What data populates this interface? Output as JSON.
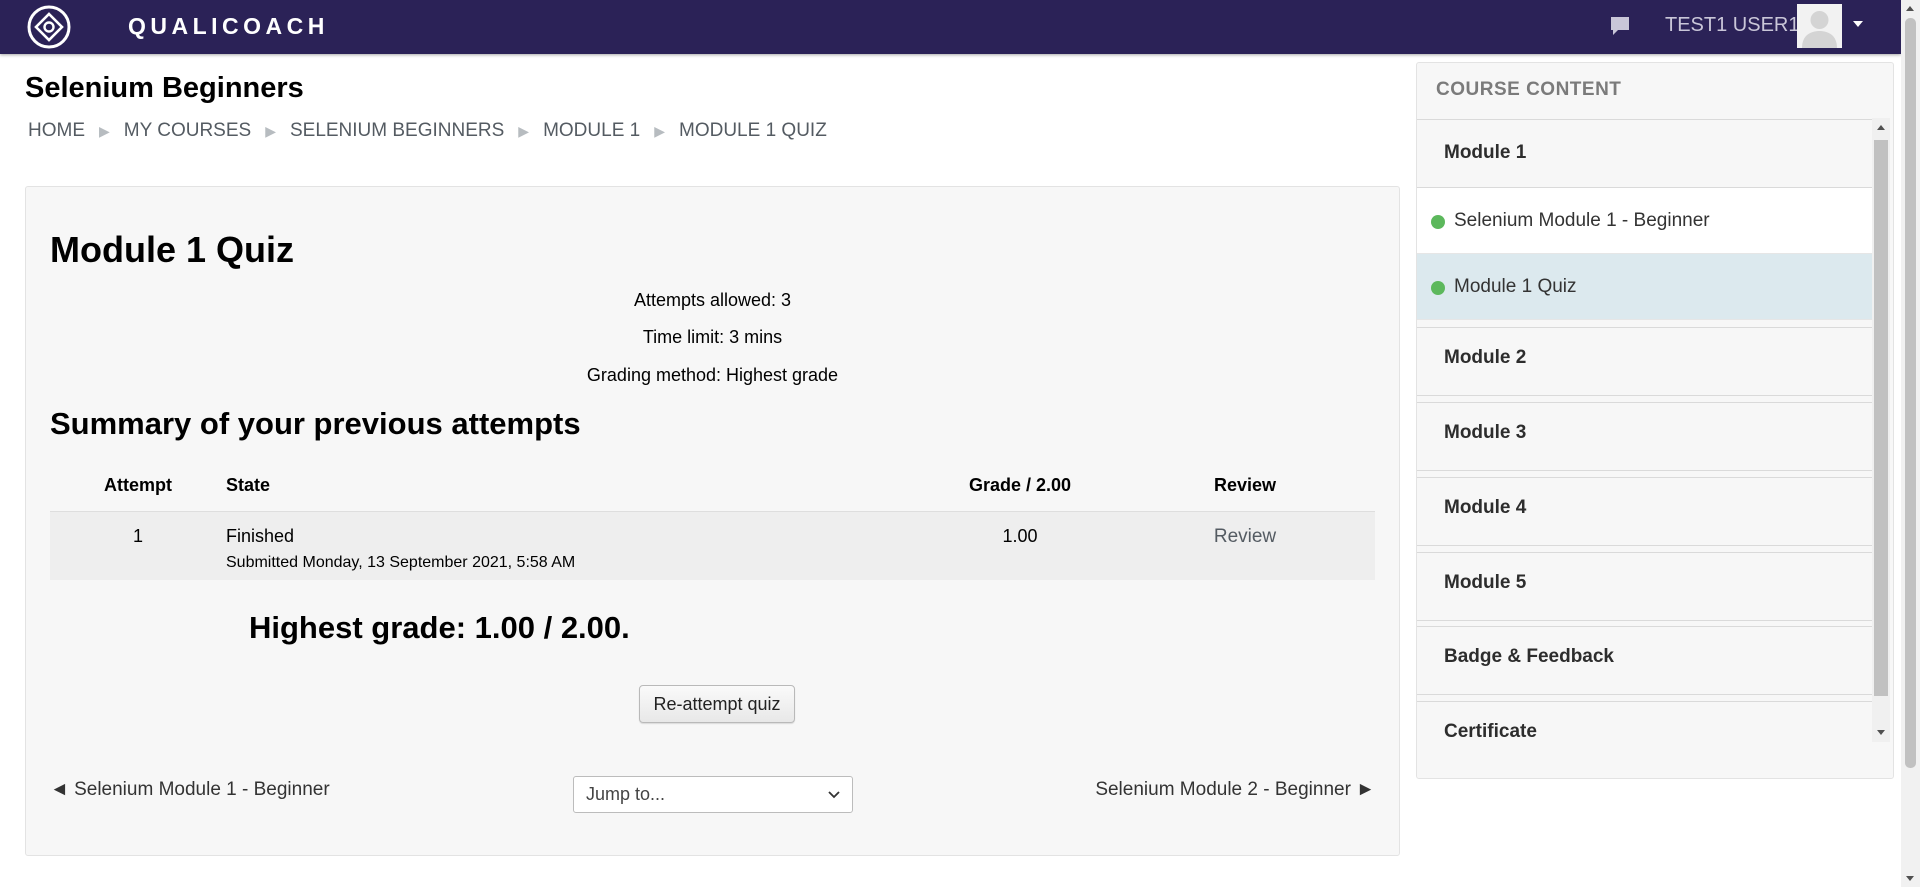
{
  "navbar": {
    "brand": "QUALICOACH",
    "username": "TEST1 USER1",
    "icons": [
      "logo-icon",
      "chat-icon",
      "avatar",
      "caret-down-icon"
    ]
  },
  "header": {
    "course_title": "Selenium Beginners",
    "breadcrumb": [
      "HOME",
      "MY COURSES",
      "SELENIUM BEGINNERS",
      "MODULE 1",
      "MODULE 1 QUIZ"
    ]
  },
  "quiz": {
    "title": "Module 1 Quiz",
    "attempts_allowed": "Attempts allowed: 3",
    "time_limit": "Time limit: 3 mins",
    "grading_method": "Grading method: Highest grade",
    "summary_title": "Summary of your previous attempts",
    "table": {
      "headers": [
        "Attempt",
        "State",
        "Grade / 2.00",
        "Review"
      ],
      "rows": [
        {
          "attempt": "1",
          "state": "Finished",
          "submitted": "Submitted Monday, 13 September 2021, 5:58 AM",
          "grade": "1.00",
          "review": "Review"
        }
      ]
    },
    "highest_grade": "Highest grade: 1.00 / 2.00.",
    "reattempt_label": "Re-attempt quiz",
    "prev_link": "◄ Selenium Module 1 - Beginner",
    "next_link": "Selenium Module 2 - Beginner ►",
    "jump_placeholder": "Jump to..."
  },
  "sidebar": {
    "heading": "COURSE CONTENT",
    "module1": "Module 1",
    "activity1": "Selenium Module 1 - Beginner",
    "activity2": "Module 1 Quiz",
    "module2": "Module 2",
    "module3": "Module 3",
    "module4": "Module 4",
    "module5": "Module 5",
    "badge": "Badge & Feedback",
    "certificate": "Certificate"
  },
  "colors": {
    "navbar": "#2b2257",
    "completion_dot": "#5cb85c",
    "active_item": "#dce9ee"
  }
}
